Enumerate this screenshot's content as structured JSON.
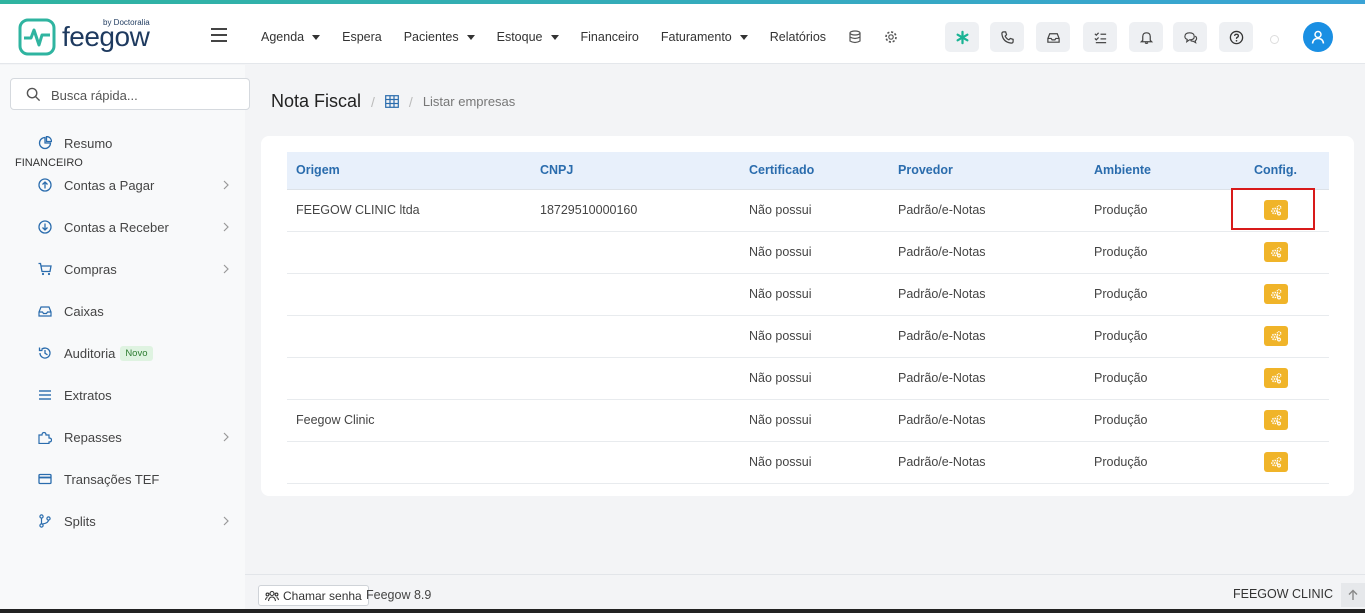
{
  "app": {
    "brand": "feegow",
    "brand_sub": "by Doctoralia"
  },
  "nav": {
    "items": [
      {
        "label": "Agenda",
        "dropdown": true
      },
      {
        "label": "Espera",
        "dropdown": false
      },
      {
        "label": "Pacientes",
        "dropdown": true
      },
      {
        "label": "Estoque",
        "dropdown": true
      },
      {
        "label": "Financeiro",
        "dropdown": false
      },
      {
        "label": "Faturamento",
        "dropdown": true
      },
      {
        "label": "Relatórios",
        "dropdown": false
      }
    ],
    "icons": [
      "database-icon",
      "gear-icon"
    ]
  },
  "toolbar": {
    "buttons": [
      "asterisk-icon",
      "phone-icon",
      "inbox-icon",
      "checklist-icon",
      "bell-icon",
      "chat-icon",
      "help-icon"
    ],
    "accent": "#1a8fe3"
  },
  "sidebar": {
    "search_placeholder": "Busca rápida...",
    "section": "FINANCEIRO",
    "items": [
      {
        "label": "Resumo",
        "icon": "chart-pie-icon",
        "has_submenu": false
      },
      {
        "label": "Contas a Pagar",
        "icon": "arrow-up-circle-icon",
        "has_submenu": true
      },
      {
        "label": "Contas a Receber",
        "icon": "arrow-down-circle-icon",
        "has_submenu": true
      },
      {
        "label": "Compras",
        "icon": "cart-icon",
        "has_submenu": true
      },
      {
        "label": "Caixas",
        "icon": "inbox-icon",
        "has_submenu": false
      },
      {
        "label": "Auditoria",
        "icon": "history-icon",
        "has_submenu": false,
        "badge": "Novo"
      },
      {
        "label": "Extratos",
        "icon": "list-icon",
        "has_submenu": false
      },
      {
        "label": "Repasses",
        "icon": "puzzle-icon",
        "has_submenu": true
      },
      {
        "label": "Transações TEF",
        "icon": "card-icon",
        "has_submenu": false
      },
      {
        "label": "Splits",
        "icon": "branch-icon",
        "has_submenu": true
      }
    ]
  },
  "breadcrumb": {
    "title": "Nota Fiscal",
    "separator": "/",
    "link": "Listar empresas"
  },
  "table": {
    "headers": [
      "Origem",
      "CNPJ",
      "Certificado",
      "Provedor",
      "Ambiente",
      "Config."
    ],
    "rows": [
      {
        "origem": "FEEGOW CLINIC ltda",
        "cnpj": "18729510000160",
        "certificado": "Não possui",
        "provedor": "Padrão/e-Notas",
        "ambiente": "Produção"
      },
      {
        "origem": "",
        "cnpj": "",
        "certificado": "Não possui",
        "provedor": "Padrão/e-Notas",
        "ambiente": "Produção"
      },
      {
        "origem": "",
        "cnpj": "",
        "certificado": "Não possui",
        "provedor": "Padrão/e-Notas",
        "ambiente": "Produção"
      },
      {
        "origem": "",
        "cnpj": "",
        "certificado": "Não possui",
        "provedor": "Padrão/e-Notas",
        "ambiente": "Produção"
      },
      {
        "origem": "",
        "cnpj": "",
        "certificado": "Não possui",
        "provedor": "Padrão/e-Notas",
        "ambiente": "Produção"
      },
      {
        "origem": "Feegow Clinic",
        "cnpj": "",
        "certificado": "Não possui",
        "provedor": "Padrão/e-Notas",
        "ambiente": "Produção"
      },
      {
        "origem": "",
        "cnpj": "",
        "certificado": "Não possui",
        "provedor": "Padrão/e-Notas",
        "ambiente": "Produção"
      }
    ],
    "config_button_color": "#f0b429"
  },
  "footer": {
    "call_button": "Chamar senha",
    "version": "Feegow 8.9",
    "clinic": "FEEGOW CLINIC"
  }
}
